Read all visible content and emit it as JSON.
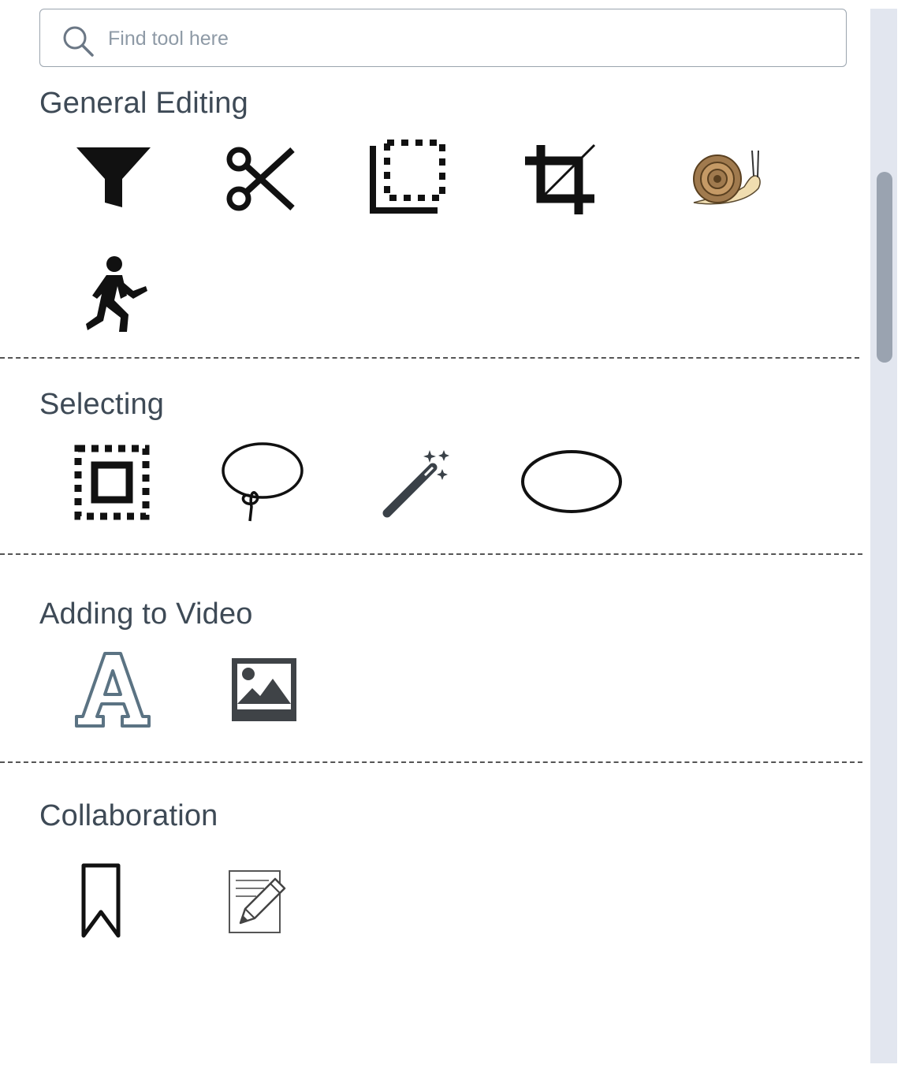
{
  "search": {
    "placeholder": "Find tool here",
    "value": ""
  },
  "sections": [
    {
      "title": "General Editing",
      "tools": [
        "filter-icon",
        "scissors-icon",
        "trim-corner-icon",
        "crop-icon",
        "snail-slow-motion-icon",
        "running-person-icon"
      ]
    },
    {
      "title": "Selecting",
      "tools": [
        "rectangle-select-icon",
        "lasso-icon",
        "magic-wand-icon",
        "ellipse-select-icon"
      ]
    },
    {
      "title": "Adding to Video",
      "tools": [
        "text-letter-a-icon",
        "image-icon"
      ]
    },
    {
      "title": "Collaboration",
      "tools": [
        "bookmark-icon",
        "note-edit-icon"
      ]
    }
  ],
  "colors": {
    "title_text": "#3e4a56",
    "scrollbar_track": "#e2e6ef",
    "scrollbar_thumb": "#9aa3b0"
  }
}
